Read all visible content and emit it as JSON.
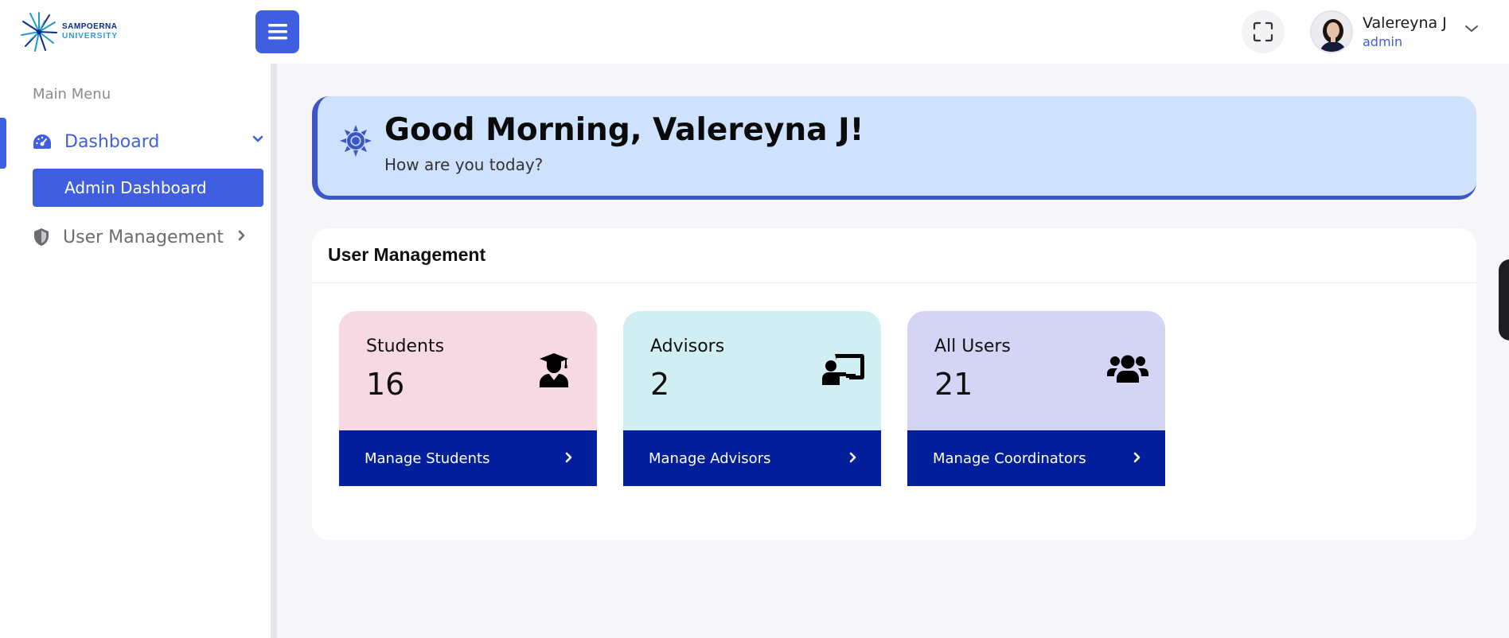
{
  "brand": {
    "line1": "SAMPOERNA",
    "line2": "UNIVERSITY",
    "logo_icon": "starburst-logo-icon"
  },
  "header": {
    "menu_icon": "hamburger-icon",
    "fullscreen_icon": "fullscreen-icon",
    "user": {
      "name": "Valereyna J",
      "role": "admin",
      "dropdown_icon": "chevron-down-icon"
    }
  },
  "sidebar": {
    "section_title": "Main Menu",
    "items": [
      {
        "label": "Dashboard",
        "icon": "gauge-icon",
        "expanded": true,
        "children": [
          {
            "label": "Admin Dashboard",
            "active": true
          }
        ]
      },
      {
        "label": "User Management",
        "icon": "shield-icon",
        "expanded": false
      }
    ]
  },
  "greeting": {
    "title": "Good Morning, Valereyna J!",
    "subtitle": "How are you today?",
    "icon": "sun-icon"
  },
  "user_management": {
    "title": "User Management",
    "cards": [
      {
        "label": "Students",
        "value": "16",
        "icon": "graduate-icon",
        "action": "Manage Students",
        "color": "#f6d9e2"
      },
      {
        "label": "Advisors",
        "value": "2",
        "icon": "chalkboard-teacher-icon",
        "action": "Manage Advisors",
        "color": "#d1eef3"
      },
      {
        "label": "All Users",
        "value": "21",
        "icon": "users-icon",
        "action": "Manage Coordinators",
        "color": "#d4d5f5"
      }
    ]
  },
  "colors": {
    "accent": "#3f5fe0",
    "action_bar": "#031f9c",
    "banner": "#cfe2fd"
  }
}
